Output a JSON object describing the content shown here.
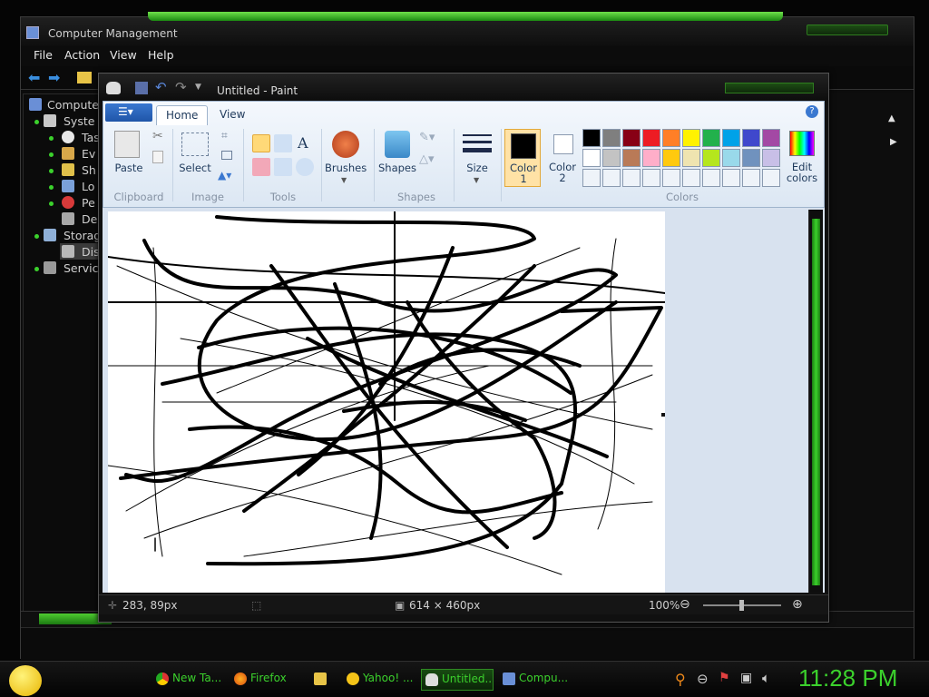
{
  "computer_management": {
    "title": "Computer Management",
    "menu": [
      "File",
      "Action",
      "View",
      "Help"
    ],
    "tree": [
      {
        "label": "Compute",
        "icon": "computer-icon"
      },
      {
        "label": "Syste",
        "icon": "tools-icon"
      },
      {
        "label": "Tas",
        "icon": "clock-icon"
      },
      {
        "label": "Ev",
        "icon": "event-viewer-icon"
      },
      {
        "label": "Sh",
        "icon": "shared-folder-icon"
      },
      {
        "label": "Lo",
        "icon": "users-icon"
      },
      {
        "label": "Pe",
        "icon": "performance-icon"
      },
      {
        "label": "De",
        "icon": "device-manager-icon"
      },
      {
        "label": "Storag",
        "icon": "storage-icon"
      },
      {
        "label": "Dis",
        "icon": "disk-icon"
      },
      {
        "label": "Servic",
        "icon": "services-icon"
      }
    ]
  },
  "paint": {
    "title": "Untitled - Paint",
    "tabs": [
      "Home",
      "View"
    ],
    "groups": {
      "clipboard": "Clipboard",
      "image": "Image",
      "tools": "Tools",
      "shapes": "Shapes",
      "colors": "Colors"
    },
    "buttons": {
      "paste": "Paste",
      "select": "Select",
      "brushes": "Brushes",
      "shapes": "Shapes",
      "size": "Size",
      "color1": "Color 1",
      "color2": "Color 2",
      "edit_colors": "Edit colors"
    },
    "palette": [
      "#000000",
      "#7f7f7f",
      "#880015",
      "#ed1c24",
      "#ff7f27",
      "#fff200",
      "#22b14c",
      "#00a2e8",
      "#3f48cc",
      "#a349a4",
      "#ffffff",
      "#c3c3c3",
      "#b97a57",
      "#ffaec9",
      "#ffc90e",
      "#efe4b0",
      "#b5e61d",
      "#99d9ea",
      "#7092be",
      "#c8bfe7"
    ],
    "color1": "#000000",
    "color2": "#ffffff",
    "status": {
      "cursor": "283, 89px",
      "canvas_size": "614 × 460px",
      "zoom": "100%"
    }
  },
  "taskbar": {
    "items": [
      {
        "label": "New Ta...",
        "icon": "chrome-icon"
      },
      {
        "label": "Firefox",
        "icon": "firefox-icon"
      },
      {
        "label": "",
        "icon": "folder-icon"
      },
      {
        "label": "Yahoo! ...",
        "icon": "yahoo-icon"
      },
      {
        "label": "Untitled...",
        "icon": "paint-icon"
      },
      {
        "label": "Compu...",
        "icon": "computer-management-icon"
      }
    ],
    "clock": "11:28 PM"
  }
}
